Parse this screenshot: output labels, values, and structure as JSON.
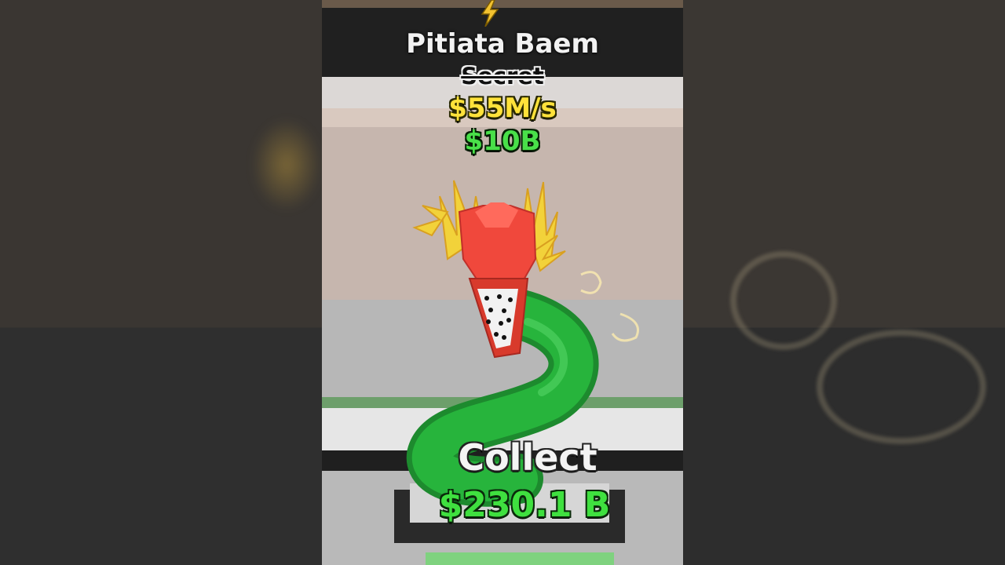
{
  "brainrot": {
    "name": "Pitiata Baem",
    "rarity": "Secret",
    "income_rate": "$55M/s",
    "price": "$10B",
    "rarity_icon": "lightning-bolt-icon"
  },
  "collect_pad": {
    "label": "Collect",
    "amount": "$230.1 B"
  },
  "colors": {
    "rate_yellow": "#ffe23a",
    "price_green": "#49e049",
    "collect_green": "#3fe03f",
    "creature_head_red": "#f0483c",
    "creature_body_green": "#27b43c"
  }
}
